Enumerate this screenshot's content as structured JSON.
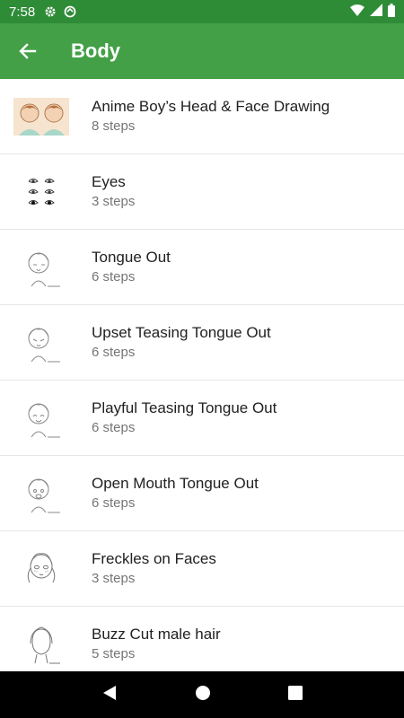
{
  "status_bar": {
    "time": "7:58"
  },
  "app_bar": {
    "title": "Body"
  },
  "items": [
    {
      "title": "Anime Boy’s Head & Face Drawing",
      "steps": "8 steps"
    },
    {
      "title": "Eyes",
      "steps": "3 steps"
    },
    {
      "title": "Tongue Out",
      "steps": "6 steps"
    },
    {
      "title": "Upset Teasing Tongue Out",
      "steps": "6 steps"
    },
    {
      "title": "Playful Teasing Tongue Out",
      "steps": "6 steps"
    },
    {
      "title": "Open Mouth Tongue Out",
      "steps": "6 steps"
    },
    {
      "title": "Freckles on Faces",
      "steps": "3 steps"
    },
    {
      "title": "Buzz Cut male hair",
      "steps": "5 steps"
    }
  ],
  "colors": {
    "status_bar": "#2e8b36",
    "app_bar": "#43a047",
    "nav_bar": "#000000"
  }
}
